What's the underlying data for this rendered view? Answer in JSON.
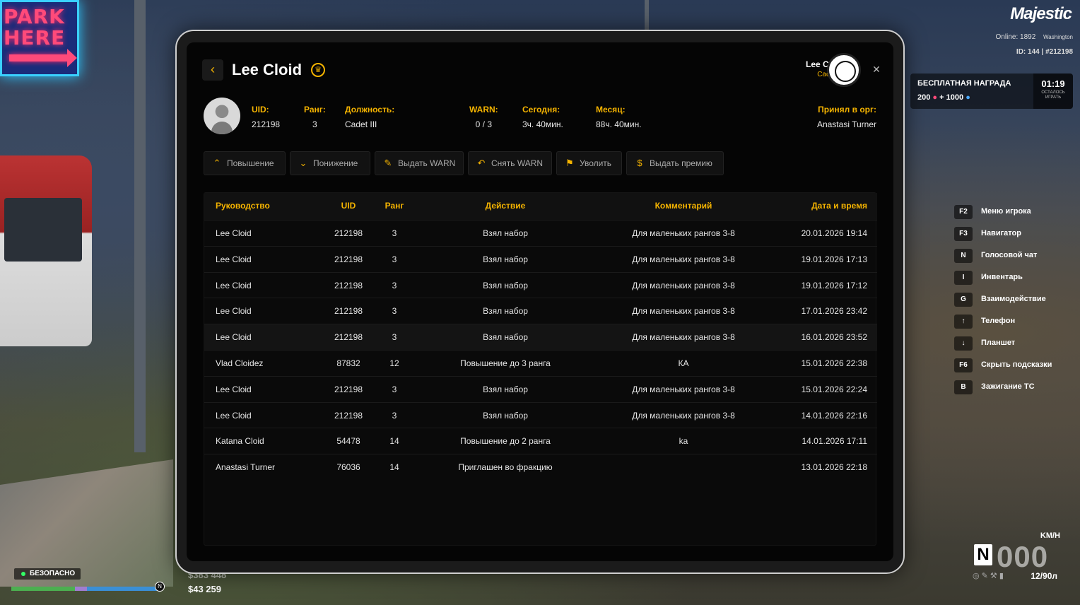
{
  "background": {
    "park_sign": [
      "PARK",
      "HERE"
    ],
    "safety_status": "БЕЗОПАСНО",
    "minimap_badge": "N",
    "money_bank": "$383 448",
    "money_cash": "$43 259"
  },
  "hud": {
    "brand": "Majestic",
    "online": "Online: 1892",
    "city": "Washington",
    "id_line": "ID: 144 | #212198",
    "reward": {
      "title": "БЕСПЛАТНАЯ НАГРАДА",
      "value_a": "200",
      "plus": "+",
      "value_b": "1000",
      "timer": "01:19",
      "timer_label": "ОСТАЛОСЬ ИГРАТЬ"
    },
    "hints": [
      {
        "key": "F2",
        "label": "Меню игрока"
      },
      {
        "key": "F3",
        "label": "Навигатор"
      },
      {
        "key": "N",
        "label": "Голосовой чат"
      },
      {
        "key": "I",
        "label": "Инвентарь"
      },
      {
        "key": "G",
        "label": "Взаимодействие"
      },
      {
        "key": "↑",
        "label": "Телефон"
      },
      {
        "key": "↓",
        "label": "Планшет"
      },
      {
        "key": "F6",
        "label": "Скрыть подсказки"
      },
      {
        "key": "B",
        "label": "Зажигание ТС"
      }
    ],
    "speedometer": {
      "unit": "KM/H",
      "gear": "N",
      "speed": "000",
      "fuel": "12/90л"
    }
  },
  "tablet": {
    "back_icon": "‹",
    "title": "Lee Cloid",
    "user": {
      "name": "Lee Cloid",
      "rank": "Cadet III"
    },
    "close_icon": "✕",
    "stats": {
      "uid_label": "UID:",
      "uid": "212198",
      "rank_label": "Ранг:",
      "rank": "3",
      "position_label": "Должность:",
      "position": "Cadet III",
      "warn_label": "WARN:",
      "warn": "0 / 3",
      "today_label": "Сегодня:",
      "today": "3ч. 40мин.",
      "month_label": "Месяц:",
      "month": "88ч. 40мин.",
      "accepted_label": "Принял в орг:",
      "accepted": "Anastasi Turner"
    },
    "actions": [
      {
        "label": "Повышение",
        "icon": "promote-icon"
      },
      {
        "label": "Понижение",
        "icon": "demote-icon"
      },
      {
        "label": "Выдать WARN",
        "icon": "warn-icon"
      },
      {
        "label": "Снять WARN",
        "icon": "undo-icon"
      },
      {
        "label": "Уволить",
        "icon": "fire-icon"
      },
      {
        "label": "Выдать премию",
        "icon": "bonus-icon"
      }
    ],
    "table": {
      "columns": [
        "Руководство",
        "UID",
        "Ранг",
        "Действие",
        "Комментарий",
        "Дата и время"
      ],
      "rows": [
        [
          "Lee Cloid",
          "212198",
          "3",
          "Взял набор",
          "Для маленьких рангов 3-8",
          "20.01.2026 19:14"
        ],
        [
          "Lee Cloid",
          "212198",
          "3",
          "Взял набор",
          "Для маленьких рангов 3-8",
          "19.01.2026 17:13"
        ],
        [
          "Lee Cloid",
          "212198",
          "3",
          "Взял набор",
          "Для маленьких рангов 3-8",
          "19.01.2026 17:12"
        ],
        [
          "Lee Cloid",
          "212198",
          "3",
          "Взял набор",
          "Для маленьких рангов 3-8",
          "17.01.2026 23:42"
        ],
        [
          "Lee Cloid",
          "212198",
          "3",
          "Взял набор",
          "Для маленьких рангов 3-8",
          "16.01.2026 23:52"
        ],
        [
          "Vlad Cloidez",
          "87832",
          "12",
          "Повышение до 3 ранга",
          "КА",
          "15.01.2026 22:38"
        ],
        [
          "Lee Cloid",
          "212198",
          "3",
          "Взял набор",
          "Для маленьких рангов 3-8",
          "15.01.2026 22:24"
        ],
        [
          "Lee Cloid",
          "212198",
          "3",
          "Взял набор",
          "Для маленьких рангов 3-8",
          "14.01.2026 22:16"
        ],
        [
          "Katana Cloid",
          "54478",
          "14",
          "Повышение до 2 ранга",
          "ka",
          "14.01.2026 17:11"
        ],
        [
          "Anastasi Turner",
          "76036",
          "14",
          "Приглашен во фракцию",
          "",
          "13.01.2026 22:18"
        ]
      ],
      "highlighted_row": 4
    }
  }
}
